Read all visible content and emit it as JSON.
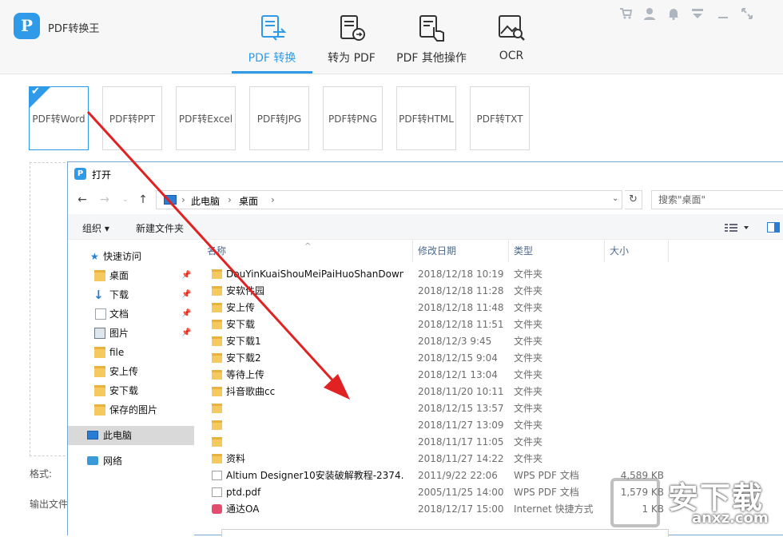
{
  "app": {
    "name": "PDF转换王",
    "logo_letter": "P",
    "nav_tabs": [
      {
        "label": "PDF 转换",
        "icon": "convert-icon",
        "active": true
      },
      {
        "label": "转为 PDF",
        "icon": "to-pdf-icon",
        "active": false
      },
      {
        "label": "PDF 其他操作",
        "icon": "hand-doc-icon",
        "active": false
      },
      {
        "label": "OCR",
        "icon": "image-search-icon",
        "active": false
      }
    ],
    "window_controls": [
      "cart-icon",
      "user-icon",
      "bell-icon",
      "dropdown-icon",
      "minimize-icon",
      "restore-icon"
    ],
    "formats": [
      "PDF转Word",
      "PDF转PPT",
      "PDF转Excel",
      "PDF转JPG",
      "PDF转PNG",
      "PDF转HTML",
      "PDF转TXT"
    ],
    "selected_format": "PDF转Word",
    "format_label": "格式:",
    "output_label": "输出文件",
    "accent": "#2f9be8"
  },
  "dialog": {
    "title": "打开",
    "logo_letter": "P",
    "breadcrumb": [
      "此电脑",
      "桌面"
    ],
    "search_placeholder": "搜索\"桌面\"",
    "toolbar": {
      "organize": "组织 ▾",
      "new_folder": "新建文件夹"
    },
    "sidebar": [
      {
        "label": "快速访问",
        "icon": "star-icon",
        "pinned": false
      },
      {
        "label": "桌面",
        "icon": "folder-icon",
        "pinned": true
      },
      {
        "label": "下载",
        "icon": "download-icon",
        "pinned": true
      },
      {
        "label": "文档",
        "icon": "document-icon",
        "pinned": true
      },
      {
        "label": "图片",
        "icon": "picture-icon",
        "pinned": true
      },
      {
        "label": "file",
        "icon": "folder-icon",
        "pinned": false
      },
      {
        "label": "安上传",
        "icon": "folder-icon",
        "pinned": false
      },
      {
        "label": "安下载",
        "icon": "folder-icon",
        "pinned": false
      },
      {
        "label": "保存的图片",
        "icon": "folder-icon",
        "pinned": false
      },
      {
        "label": "此电脑",
        "icon": "computer-icon",
        "pinned": false,
        "selected": true
      },
      {
        "label": "网络",
        "icon": "network-icon",
        "pinned": false
      }
    ],
    "columns": [
      "名称",
      "修改日期",
      "类型",
      "大小"
    ],
    "files": [
      {
        "name": "DouYinKuaiShouMeiPaiHuoShanDown",
        "date": "2018/12/18 10:19",
        "type": "文件夹",
        "size": "",
        "kind": "folder"
      },
      {
        "name": "安软件园",
        "date": "2018/12/18 11:28",
        "type": "文件夹",
        "size": "",
        "kind": "folder"
      },
      {
        "name": "安上传",
        "date": "2018/12/18 11:48",
        "type": "文件夹",
        "size": "",
        "kind": "folder"
      },
      {
        "name": "安下载",
        "date": "2018/12/18 11:51",
        "type": "文件夹",
        "size": "",
        "kind": "folder"
      },
      {
        "name": "安下载1",
        "date": "2018/12/3 9:45",
        "type": "文件夹",
        "size": "",
        "kind": "folder"
      },
      {
        "name": "安下载2",
        "date": "2018/12/15 9:04",
        "type": "文件夹",
        "size": "",
        "kind": "folder"
      },
      {
        "name": "等待上传",
        "date": "2018/12/1 13:04",
        "type": "文件夹",
        "size": "",
        "kind": "folder"
      },
      {
        "name": "抖音歌曲cc",
        "date": "2018/11/20 10:11",
        "type": "文件夹",
        "size": "",
        "kind": "folder"
      },
      {
        "name": "",
        "date": "2018/12/15 13:57",
        "type": "文件夹",
        "size": "",
        "kind": "folder"
      },
      {
        "name": "",
        "date": "2018/11/27 13:09",
        "type": "文件夹",
        "size": "",
        "kind": "folder"
      },
      {
        "name": "",
        "date": "2018/11/17 11:05",
        "type": "文件夹",
        "size": "",
        "kind": "folder"
      },
      {
        "name": "资料",
        "date": "2018/11/27 14:22",
        "type": "文件夹",
        "size": "",
        "kind": "folder"
      },
      {
        "name": "Altium Designer10安装破解教程-2374...",
        "date": "2011/9/22 22:06",
        "type": "WPS PDF 文档",
        "size": "4,589 KB",
        "kind": "file"
      },
      {
        "name": "ptd.pdf",
        "date": "2005/11/25 14:00",
        "type": "WPS PDF 文档",
        "size": "1,579 KB",
        "kind": "file"
      },
      {
        "name": "通达OA",
        "date": "2018/12/17 15:00",
        "type": "Internet 快捷方式",
        "size": "1 KB",
        "kind": "link"
      }
    ]
  },
  "watermark": {
    "text": "安下载",
    "url": "anxz.com"
  }
}
